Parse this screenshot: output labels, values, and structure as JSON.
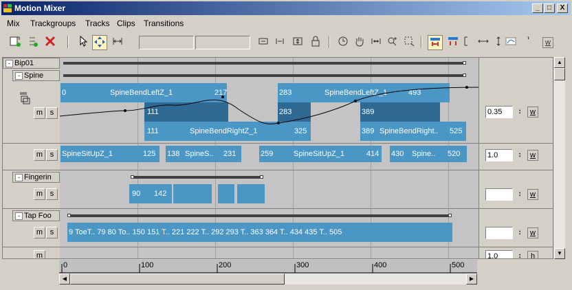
{
  "window": {
    "title": "Motion Mixer",
    "min": "_",
    "max": "□",
    "close": "X"
  },
  "menu": [
    "Mix",
    "Trackgroups",
    "Tracks",
    "Clips",
    "Transitions"
  ],
  "tree": {
    "bip": "Bip01",
    "spine": "Spine",
    "fingering": "Fingerin",
    "tapfoot": "Tap Foo"
  },
  "track_buttons": {
    "m": "m",
    "s": "s"
  },
  "spine_upper": {
    "clip_a": {
      "start": "0",
      "name": "SpineBendLeftZ_1",
      "end": "217"
    },
    "clip_b": {
      "start": "283",
      "name": "SpineBendLeftZ_1",
      "end": "493"
    },
    "trans_1": "111",
    "trans_2": "283",
    "trans_3": "389",
    "clip_c": {
      "start": "111",
      "name": "SpineBendRightZ_1",
      "end": "325"
    },
    "clip_d": {
      "start": "389",
      "name": "SpineBendRight..",
      "end": "525"
    },
    "weight": "0.35"
  },
  "spine_lower": {
    "clips": [
      {
        "start": "SpineSitUpZ_1",
        "end": "125"
      },
      {
        "start": "138",
        "name": "SpineS..",
        "end": "231"
      },
      {
        "start": "259",
        "name": "SpineSitUpZ_1",
        "end": "414"
      },
      {
        "start": "430",
        "name": "Spine..",
        "end": "520"
      }
    ],
    "weight": "1.0"
  },
  "fingering": {
    "a": "90",
    "b": "142",
    "weight": ""
  },
  "tapfoot": {
    "text": "9  ToeT.. 79 80  To.. 150 151  T..  221 222  T..  292 293  T..  363 364  T..  434 435  T..  505",
    "weight": ""
  },
  "last_row": {
    "weight": "1.0",
    "btn": "h"
  },
  "weight_btn": "w",
  "spin_glyph": "↕",
  "ruler": [
    "0",
    "100",
    "200",
    "300",
    "400",
    "500"
  ]
}
